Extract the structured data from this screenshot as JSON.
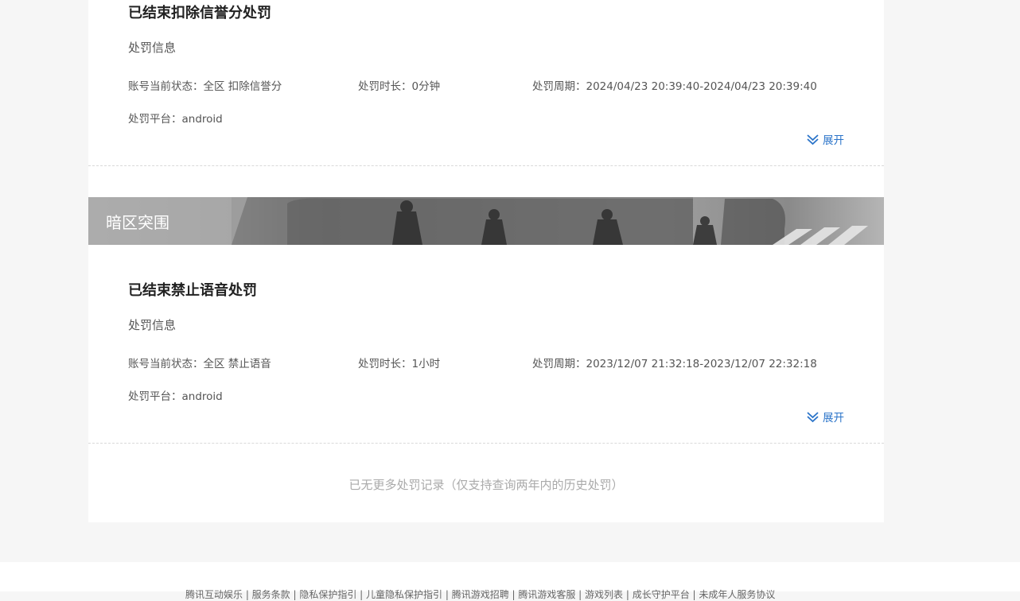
{
  "records": [
    {
      "title": "已结束扣除信誉分处罚",
      "info_label": "处罚信息",
      "status": "账号当前状态：全区 扣除信誉分",
      "duration": "处罚时长：0分钟",
      "period": "处罚周期：2024/04/23 20:39:40-2024/04/23 20:39:40",
      "platform": "处罚平台：android",
      "expand_label": "展开"
    },
    {
      "game_title": "暗区突围",
      "title": "已结束禁止语音处罚",
      "info_label": "处罚信息",
      "status": "账号当前状态：全区 禁止语音",
      "duration": "处罚时长：1小时",
      "period": "处罚周期：2023/12/07 21:32:18-2023/12/07 22:32:18",
      "platform": "处罚平台：android",
      "expand_label": "展开"
    }
  ],
  "no_more_text": "已无更多处罚记录（仅支持查询两年内的历史处罚）",
  "footer_links": "腾讯互动娱乐 | 服务条款 | 隐私保护指引 | 儿童隐私保护指引 | 腾讯游戏招聘 | 腾讯游戏客服 | 游戏列表 | 成长守护平台 | 未成年人服务协议",
  "colors": {
    "link": "#2b74c9",
    "banner_text": "#ffffff",
    "page_bg": "#f6f6f6"
  },
  "icons": {
    "expand": "double-chevron-down-icon"
  }
}
